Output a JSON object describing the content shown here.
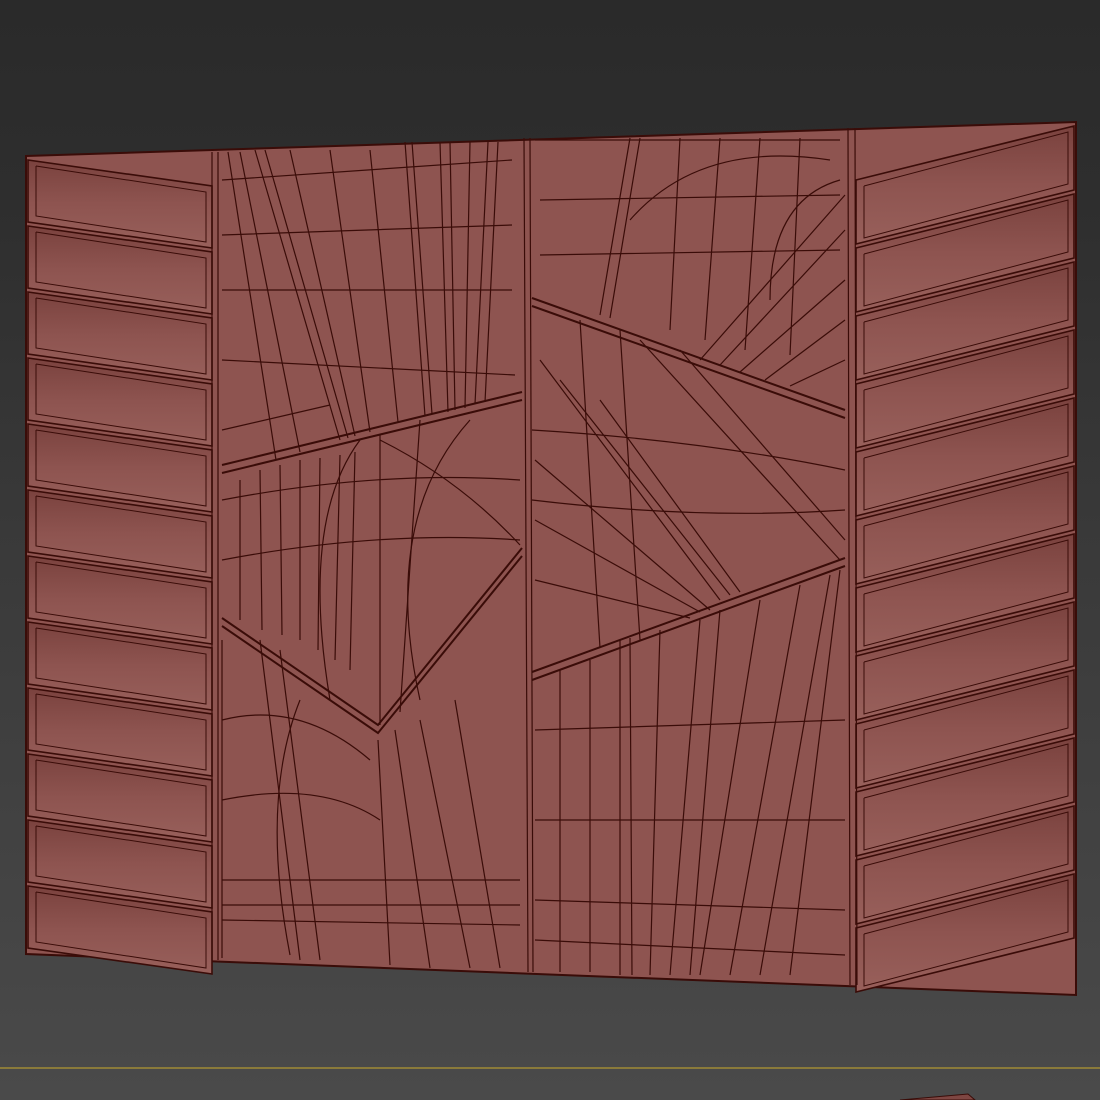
{
  "viewport": {
    "background_top": "#2a2a2a",
    "background_bottom": "#4a4a4a",
    "grid_line_color": "#8a7a3a"
  },
  "model": {
    "object": "3d-wall-panel-wireframe",
    "shading": "wireframe-over-shaded",
    "surface_color": "#8e5450",
    "surface_color_dark": "#7e4642",
    "wire_color": "#3a0c08",
    "left_slats": 12,
    "right_slats": 12
  }
}
